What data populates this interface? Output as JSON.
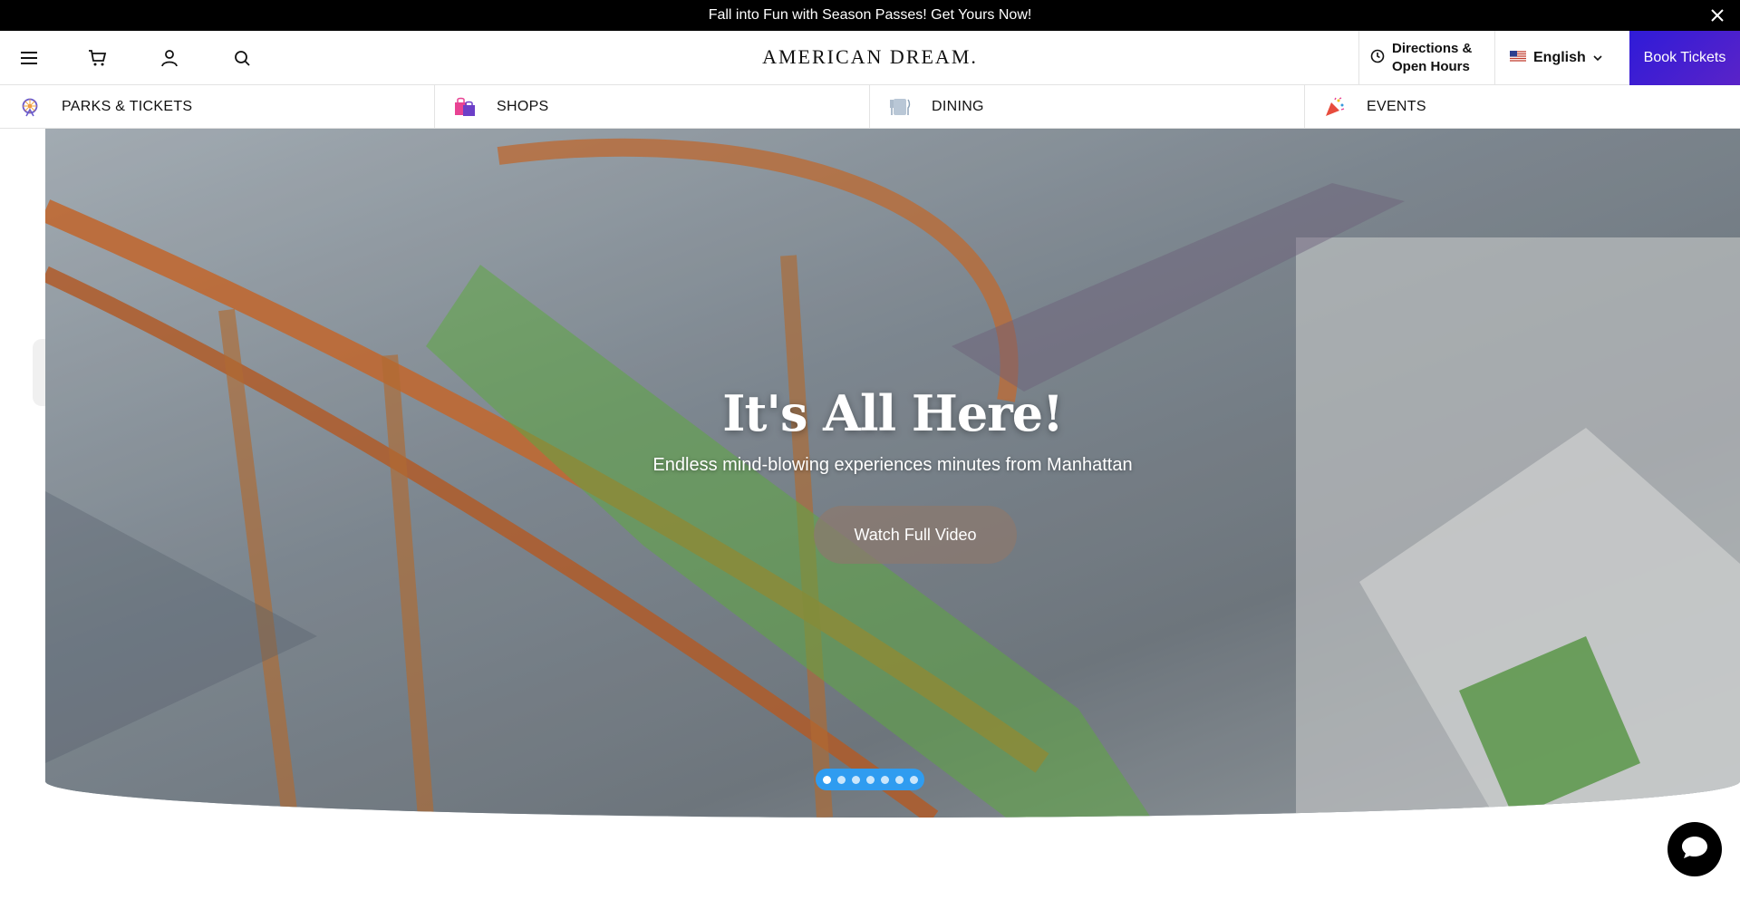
{
  "promo": {
    "text": "Fall into Fun with Season Passes! Get Yours Now!"
  },
  "header": {
    "logo": "AMERICAN DREAM.",
    "directions_label": "Directions & Open Hours",
    "language_label": "English",
    "book_tickets_label": "Book Tickets"
  },
  "nav": {
    "categories": [
      {
        "label": "PARKS & TICKETS",
        "icon": "ferris-wheel-icon"
      },
      {
        "label": "SHOPS",
        "icon": "shopping-bags-icon"
      },
      {
        "label": "DINING",
        "icon": "dining-icon"
      },
      {
        "label": "EVENTS",
        "icon": "party-popper-icon"
      }
    ]
  },
  "hero": {
    "title": "It's All Here!",
    "subtitle": "Endless mind-blowing experiences minutes from Manhattan",
    "cta_label": "Watch Full Video",
    "slide_count": 7,
    "active_slide": 1
  },
  "colors": {
    "book_tickets_bg": "#2f1bd8",
    "dots_bg": "#2f9cf0",
    "promo_bg": "#000000"
  }
}
